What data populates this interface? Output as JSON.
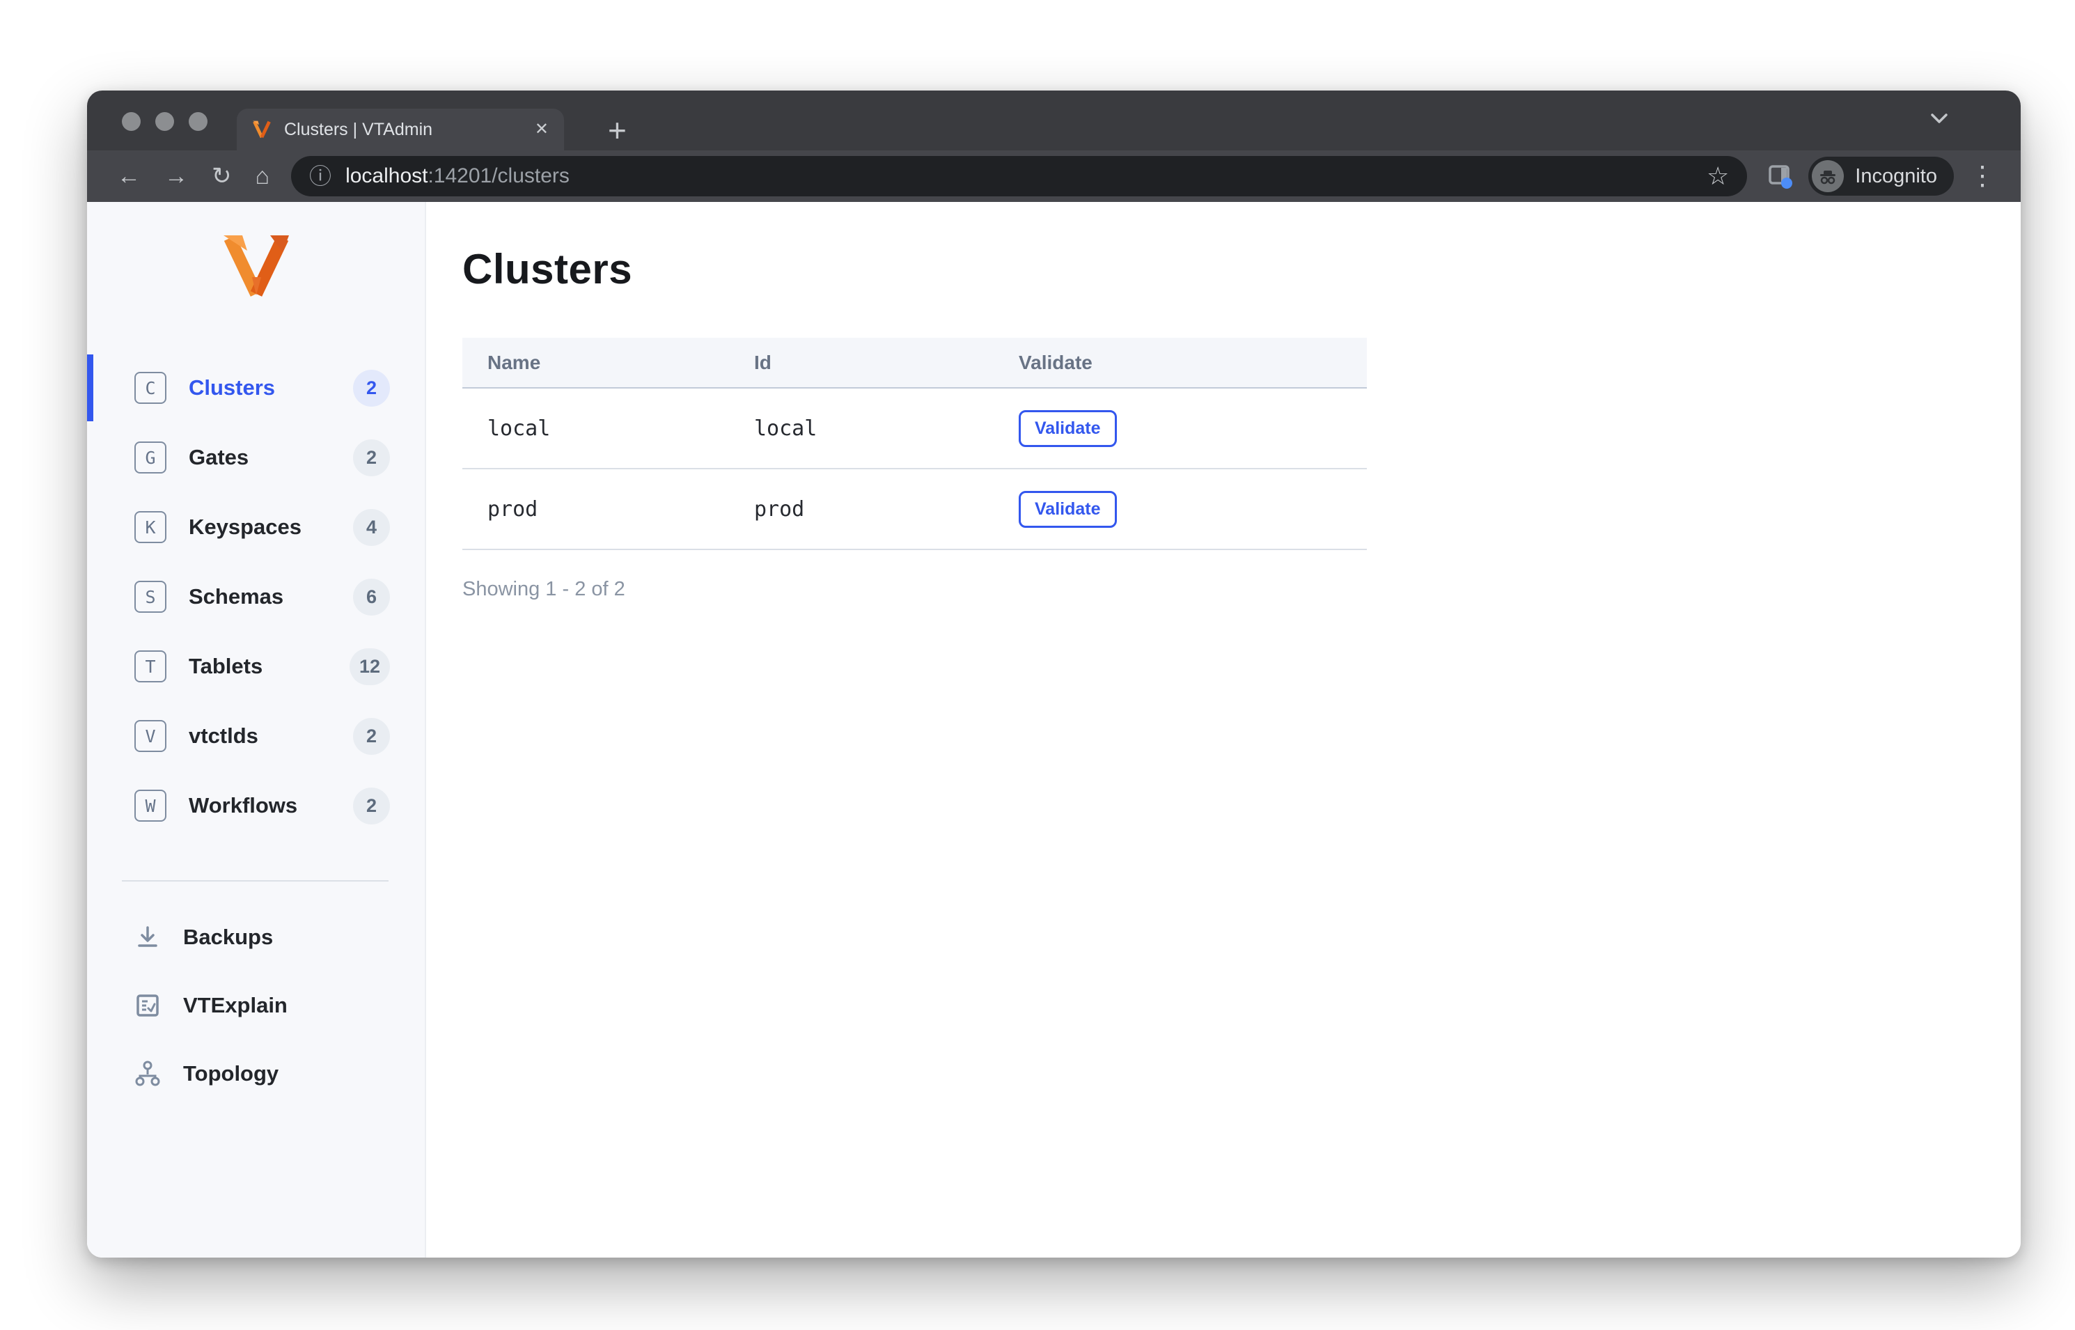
{
  "colors": {
    "accent_blue": "#3357ee",
    "logo_orange": "#f08c2e",
    "logo_orange_dark": "#e05e17",
    "sidebar_bg": "#f7f8fb",
    "badge_bg": "#e9edf2",
    "badge_active_bg": "#e3e9fb",
    "chrome_tabstrip": "#3a3b3f",
    "chrome_toolbar": "#45464b",
    "chrome_urlbar": "#1f2124",
    "sidepanel_dot_blue": "#4d8df7"
  },
  "browser": {
    "tab_title": "Clusters | VTAdmin",
    "close_glyph": "✕",
    "new_tab_glyph": "+",
    "back_glyph": "←",
    "forward_glyph": "→",
    "reload_glyph": "↻",
    "home_glyph": "⌂",
    "info_glyph": "ⓘ",
    "star_glyph": "☆",
    "menu_glyph": "⋮",
    "url_host": "localhost",
    "url_path": ":14201/clusters",
    "incognito_label": "Incognito"
  },
  "sidebar": {
    "items": [
      {
        "label": "Clusters",
        "letter": "C",
        "count": "2"
      },
      {
        "label": "Gates",
        "letter": "G",
        "count": "2"
      },
      {
        "label": "Keyspaces",
        "letter": "K",
        "count": "4"
      },
      {
        "label": "Schemas",
        "letter": "S",
        "count": "6"
      },
      {
        "label": "Tablets",
        "letter": "T",
        "count": "12"
      },
      {
        "label": "vtctlds",
        "letter": "V",
        "count": "2"
      },
      {
        "label": "Workflows",
        "letter": "W",
        "count": "2"
      }
    ],
    "tools": [
      {
        "label": "Backups"
      },
      {
        "label": "VTExplain"
      },
      {
        "label": "Topology"
      }
    ]
  },
  "main": {
    "title": "Clusters",
    "table": {
      "columns": [
        "Name",
        "Id",
        "Validate"
      ],
      "rows": [
        {
          "name": "local",
          "id": "local",
          "action_label": "Validate"
        },
        {
          "name": "prod",
          "id": "prod",
          "action_label": "Validate"
        }
      ]
    },
    "pagination": "Showing 1 - 2 of 2"
  }
}
